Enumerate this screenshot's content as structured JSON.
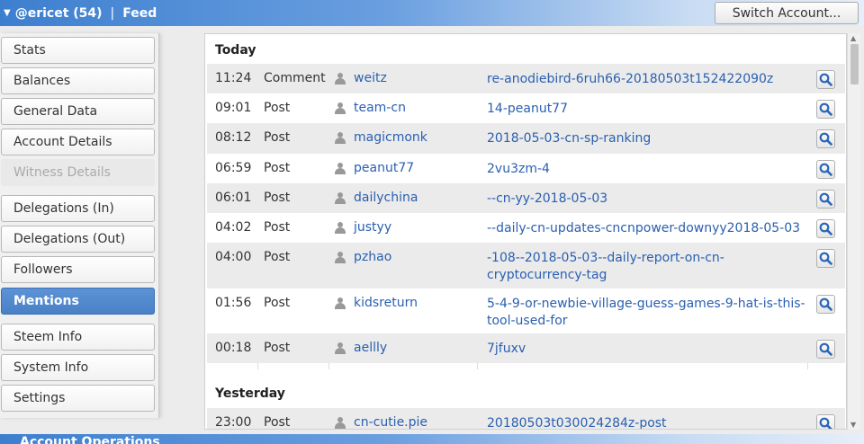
{
  "header": {
    "account": "@ericet (54)",
    "separator": "|",
    "section": "Feed",
    "switch_label": "Switch Account..."
  },
  "sidebar": {
    "items": [
      {
        "label": "Stats",
        "state": "normal"
      },
      {
        "label": "Balances",
        "state": "normal"
      },
      {
        "label": "General Data",
        "state": "normal"
      },
      {
        "label": "Account Details",
        "state": "normal"
      },
      {
        "label": "Witness Details",
        "state": "disabled"
      },
      {
        "label": "Delegations (In)",
        "state": "normal"
      },
      {
        "label": "Delegations (Out)",
        "state": "normal"
      },
      {
        "label": "Followers",
        "state": "normal"
      },
      {
        "label": "Mentions",
        "state": "active"
      },
      {
        "label": "Steem Info",
        "state": "normal"
      },
      {
        "label": "System Info",
        "state": "normal"
      },
      {
        "label": "Settings",
        "state": "normal"
      }
    ]
  },
  "feed": {
    "today_label": "Today",
    "yesterday_label": "Yesterday",
    "today": [
      {
        "time": "11:24",
        "type": "Comment",
        "user": "weitz",
        "link": "re-anodiebird-6ruh66-20180503t152422090z"
      },
      {
        "time": "09:01",
        "type": "Post",
        "user": "team-cn",
        "link": "14-peanut77"
      },
      {
        "time": "08:12",
        "type": "Post",
        "user": "magicmonk",
        "link": "2018-05-03-cn-sp-ranking"
      },
      {
        "time": "06:59",
        "type": "Post",
        "user": "peanut77",
        "link": "2vu3zm-4"
      },
      {
        "time": "06:01",
        "type": "Post",
        "user": "dailychina",
        "link": "--cn-yy-2018-05-03"
      },
      {
        "time": "04:02",
        "type": "Post",
        "user": "justyy",
        "link": "--daily-cn-updates-cncnpower-downyy2018-05-03"
      },
      {
        "time": "04:00",
        "type": "Post",
        "user": "pzhao",
        "link": "-108--2018-05-03--daily-report-on-cn-cryptocurrency-tag"
      },
      {
        "time": "01:56",
        "type": "Post",
        "user": "kidsreturn",
        "link": "5-4-9-or-newbie-village-guess-games-9-hat-is-this-tool-used-for"
      },
      {
        "time": "00:18",
        "type": "Post",
        "user": "aellly",
        "link": "7jfuxv"
      }
    ],
    "yesterday": [
      {
        "time": "23:00",
        "type": "Post",
        "user": "cn-cutie.pie",
        "link": "20180503t030024284z-post"
      }
    ]
  },
  "footer": {
    "label": "Account Operations"
  },
  "colors": {
    "accent": "#4a80c6",
    "link": "#2a5fb0"
  }
}
